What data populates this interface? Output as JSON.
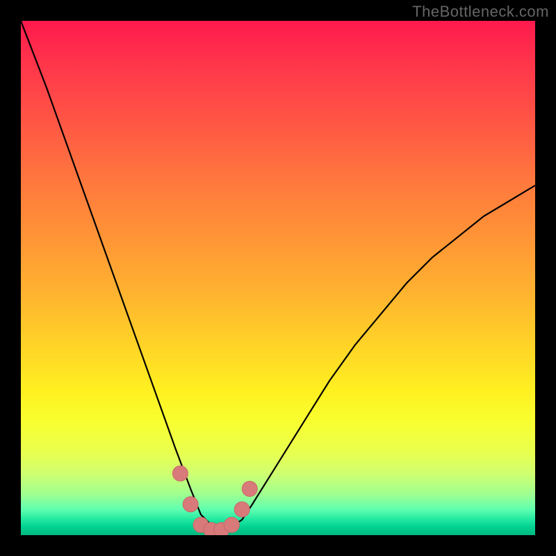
{
  "watermark": "TheBottleneck.com",
  "colors": {
    "frame": "#000000",
    "curve": "#000000",
    "marker_fill": "#d97a7a",
    "marker_stroke": "#c86868",
    "gradient_top": "#ff1a4d",
    "gradient_bottom": "#00b880"
  },
  "chart_data": {
    "type": "line",
    "title": "",
    "xlabel": "",
    "ylabel": "",
    "xlim": [
      0,
      100
    ],
    "ylim": [
      0,
      100
    ],
    "grid": false,
    "legend": false,
    "note": "Bottleneck-style V-curve; x is relative component scale, y is bottleneck %. Minimum (~0%) occurs around x≈35–40. Values estimated from pixel positions.",
    "series": [
      {
        "name": "bottleneck-curve",
        "x": [
          0,
          5,
          10,
          15,
          20,
          25,
          30,
          33,
          35,
          38,
          40,
          43,
          45,
          50,
          55,
          60,
          65,
          70,
          75,
          80,
          85,
          90,
          95,
          100
        ],
        "y": [
          100,
          87,
          73,
          59,
          45,
          31,
          17,
          9,
          4,
          1,
          1,
          3,
          6,
          14,
          22,
          30,
          37,
          43,
          49,
          54,
          58,
          62,
          65,
          68
        ]
      }
    ],
    "markers": {
      "name": "highlight-points",
      "note": "Pink dot cluster near the curve minimum",
      "points": [
        {
          "x": 31,
          "y": 12
        },
        {
          "x": 33,
          "y": 6
        },
        {
          "x": 35,
          "y": 2
        },
        {
          "x": 37,
          "y": 1
        },
        {
          "x": 39,
          "y": 1
        },
        {
          "x": 41,
          "y": 2
        },
        {
          "x": 43,
          "y": 5
        },
        {
          "x": 44.5,
          "y": 9
        }
      ]
    }
  }
}
